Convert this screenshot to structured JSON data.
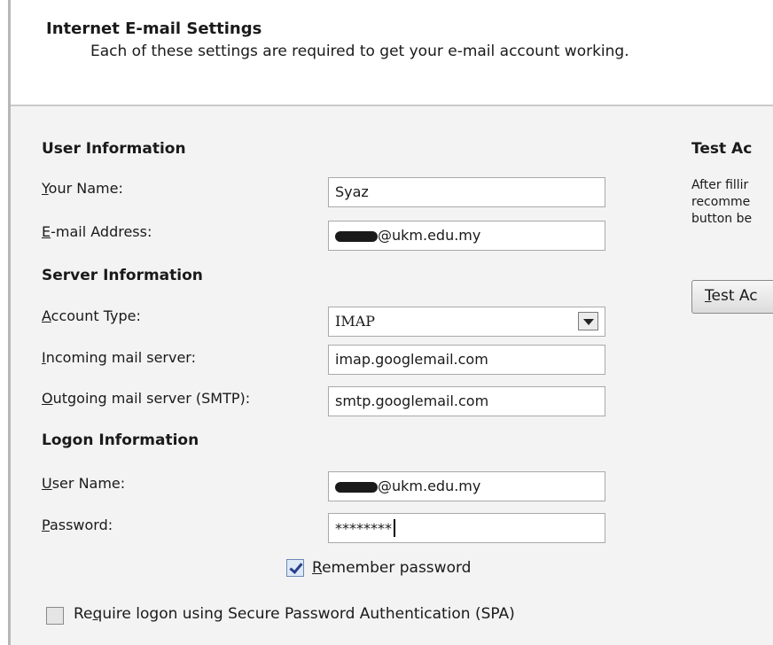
{
  "header": {
    "title": "Internet E-mail Settings",
    "subtitle": "Each of these settings are required to get your e-mail account working."
  },
  "user_info": {
    "heading": "User Information",
    "name_label": {
      "u": "Y",
      "rest": "our Name:"
    },
    "name_value": "Syaz",
    "email_label": {
      "u": "E",
      "rest": "-mail Address:"
    },
    "email_value": "@ukm.edu.my"
  },
  "server_info": {
    "heading": "Server Information",
    "account_type_label": {
      "u": "A",
      "rest": "ccount Type:"
    },
    "account_type_value": "IMAP",
    "incoming_label": {
      "u": "I",
      "rest": "ncoming mail server:"
    },
    "incoming_value": "imap.googlemail.com",
    "outgoing_label": {
      "u": "O",
      "rest": "utgoing mail server (SMTP):"
    },
    "outgoing_value": "smtp.googlemail.com"
  },
  "logon_info": {
    "heading": "Logon Information",
    "username_label": {
      "u": "U",
      "rest": "ser Name:"
    },
    "username_value": "@ukm.edu.my",
    "password_label": {
      "u": "P",
      "rest": "assword:"
    },
    "password_value": "********",
    "remember": {
      "u": "R",
      "rest": "emember password",
      "checked": true
    },
    "spa": {
      "pre": "Re",
      "u": "q",
      "rest": "uire logon using Secure Password Authentication (SPA)",
      "checked": false
    }
  },
  "test_account": {
    "heading": "Test Ac",
    "text": "After fillir\nrecomme\nbutton be",
    "button": {
      "u": "T",
      "rest": "est Ac"
    }
  }
}
